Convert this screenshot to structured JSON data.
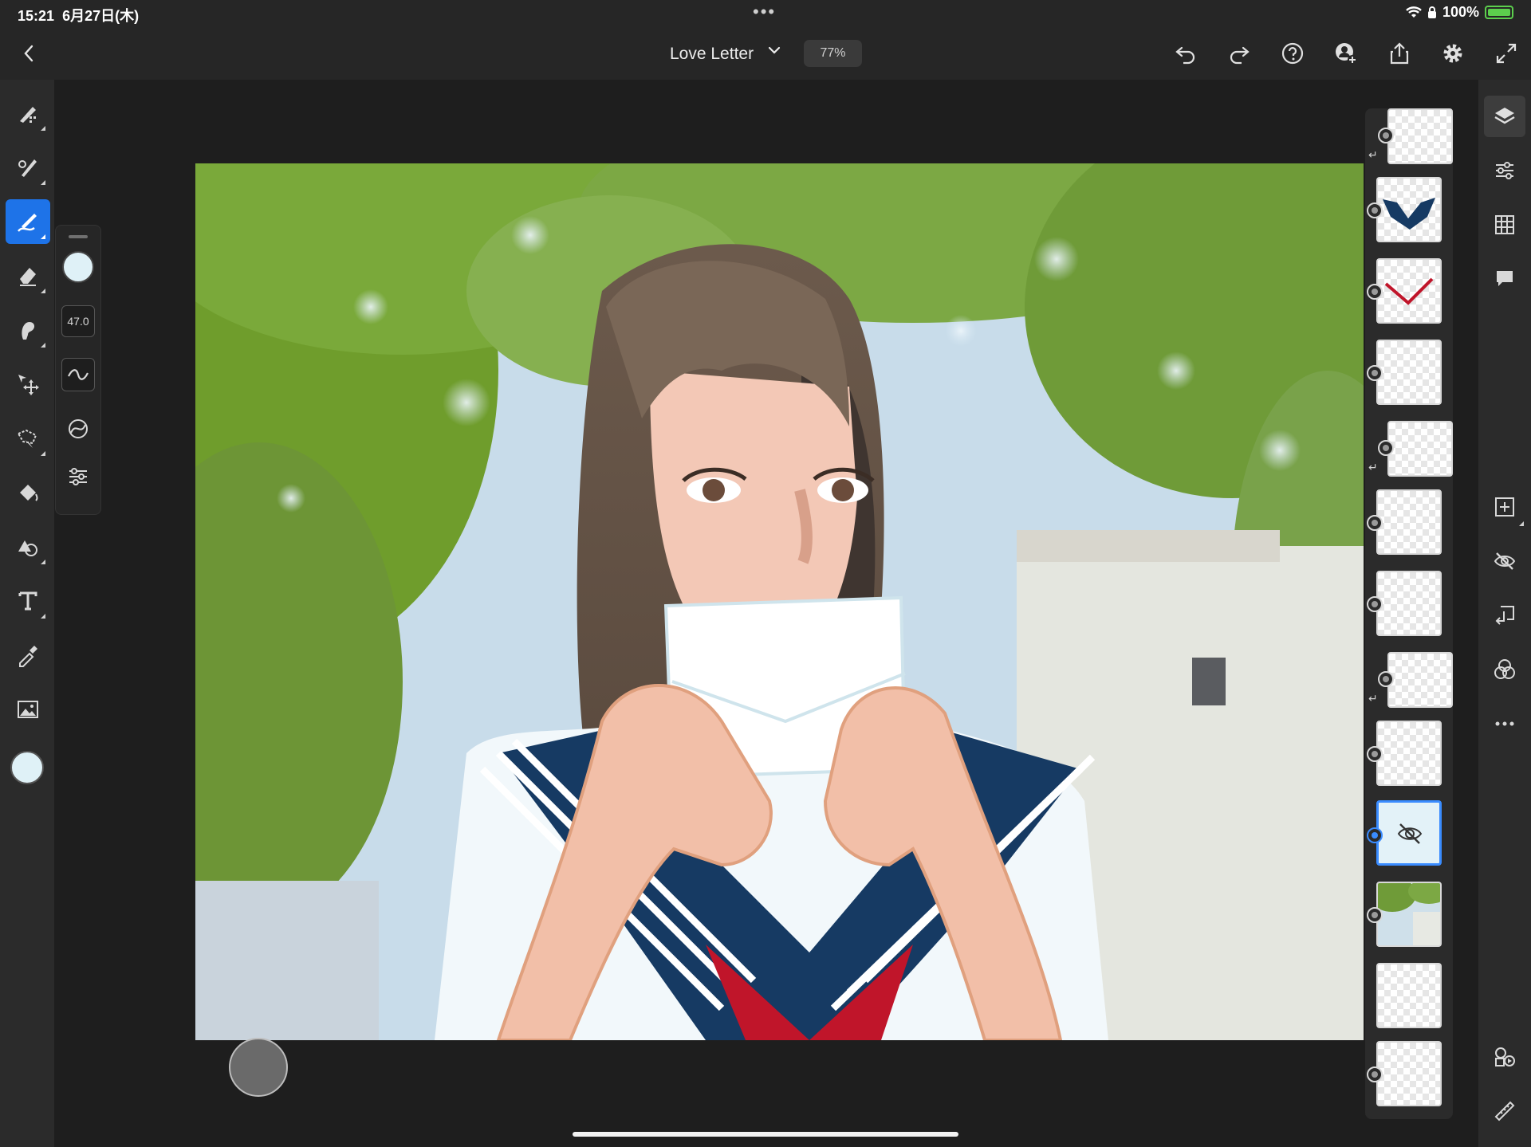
{
  "status_bar": {
    "time": "15:21",
    "date": "6月27日(木)",
    "dots": "•••",
    "battery": "100%"
  },
  "toolbar": {
    "title": "Love Letter",
    "zoom": "77%"
  },
  "brush_panel": {
    "size": "47.0"
  },
  "colors": {
    "current": "#dff1f7",
    "accent": "#1e73e8",
    "selected_layer": "#3a8cff"
  },
  "left_tools": [
    "pixel-brush-icon",
    "live-brush-icon",
    "vector-brush-icon",
    "eraser-icon",
    "smudge-icon",
    "move-icon",
    "lasso-icon",
    "fill-icon",
    "shape-icon",
    "type-icon",
    "eyedropper-icon",
    "image-icon"
  ],
  "top_tools": [
    "undo-icon",
    "redo-icon",
    "help-icon",
    "invite-icon",
    "share-icon",
    "settings-icon",
    "fullscreen-icon"
  ],
  "right_tools": [
    "layers-icon",
    "layer-properties-icon",
    "grid-icon",
    "comment-icon",
    "add-layer-icon",
    "hide-layer-icon",
    "merge-down-icon",
    "blend-mode-icon",
    "more-icon",
    "assets-icon",
    "ruler-icon"
  ],
  "layers": [
    {
      "name": "layer-1",
      "clipped": true
    },
    {
      "name": "layer-collar-navy",
      "clipped": false
    },
    {
      "name": "layer-ribbon-red",
      "clipped": false
    },
    {
      "name": "layer-4",
      "clipped": false
    },
    {
      "name": "layer-5",
      "clipped": true
    },
    {
      "name": "layer-6",
      "clipped": false
    },
    {
      "name": "layer-7",
      "clipped": false
    },
    {
      "name": "layer-8",
      "clipped": true
    },
    {
      "name": "layer-9",
      "clipped": false
    },
    {
      "name": "layer-hidden",
      "clipped": false,
      "selected": true,
      "hidden": true
    },
    {
      "name": "layer-photo",
      "clipped": false
    },
    {
      "name": "layer-12",
      "clipped": false
    },
    {
      "name": "layer-13",
      "clipped": false
    }
  ]
}
